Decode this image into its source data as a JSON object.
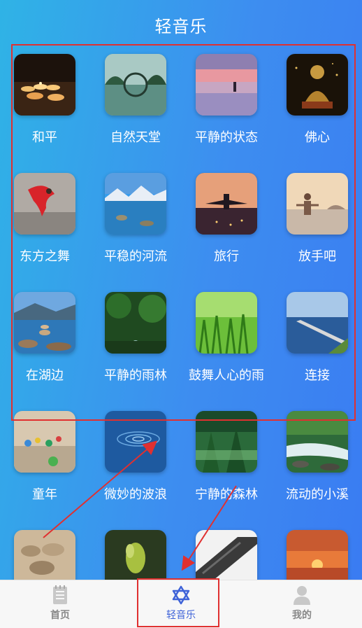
{
  "header": {
    "title": "轻音乐"
  },
  "tracks": [
    {
      "label": "和平",
      "icon": "candles-photo"
    },
    {
      "label": "自然天堂",
      "icon": "forest-bridge-photo"
    },
    {
      "label": "平静的状态",
      "icon": "sunset-lake-photo"
    },
    {
      "label": "佛心",
      "icon": "buddha-statue-photo"
    },
    {
      "label": "东方之舞",
      "icon": "dancer-photo"
    },
    {
      "label": "平稳的河流",
      "icon": "mountain-river-photo"
    },
    {
      "label": "旅行",
      "icon": "airplane-photo"
    },
    {
      "label": "放手吧",
      "icon": "meditation-beach-photo"
    },
    {
      "label": "在湖边",
      "icon": "lake-stones-photo"
    },
    {
      "label": "平静的雨林",
      "icon": "rainforest-stream-photo"
    },
    {
      "label": "鼓舞人心的雨",
      "icon": "grass-dew-photo"
    },
    {
      "label": "连接",
      "icon": "pier-sea-photo"
    },
    {
      "label": "童年",
      "icon": "marbles-photo"
    },
    {
      "label": "微妙的波浪",
      "icon": "water-ripple-photo"
    },
    {
      "label": "宁静的森林",
      "icon": "misty-forest-photo"
    },
    {
      "label": "流动的小溪",
      "icon": "creek-photo"
    },
    {
      "label": "",
      "icon": "pebbles-photo"
    },
    {
      "label": "",
      "icon": "sprout-photo"
    },
    {
      "label": "",
      "icon": "roof-tiles-photo"
    },
    {
      "label": "",
      "icon": "sea-sunset-photo"
    }
  ],
  "tabbar": {
    "items": [
      {
        "label": "首页",
        "icon": "document-icon",
        "active": false
      },
      {
        "label": "轻音乐",
        "icon": "star-of-david-icon",
        "active": true
      },
      {
        "label": "我的",
        "icon": "user-icon",
        "active": false
      }
    ]
  },
  "colors": {
    "background_start": "#2fb3e6",
    "background_end": "#3a7bf2",
    "annotation_red": "#e03030",
    "tab_active": "#3f63d8",
    "tab_inactive": "#888888"
  }
}
